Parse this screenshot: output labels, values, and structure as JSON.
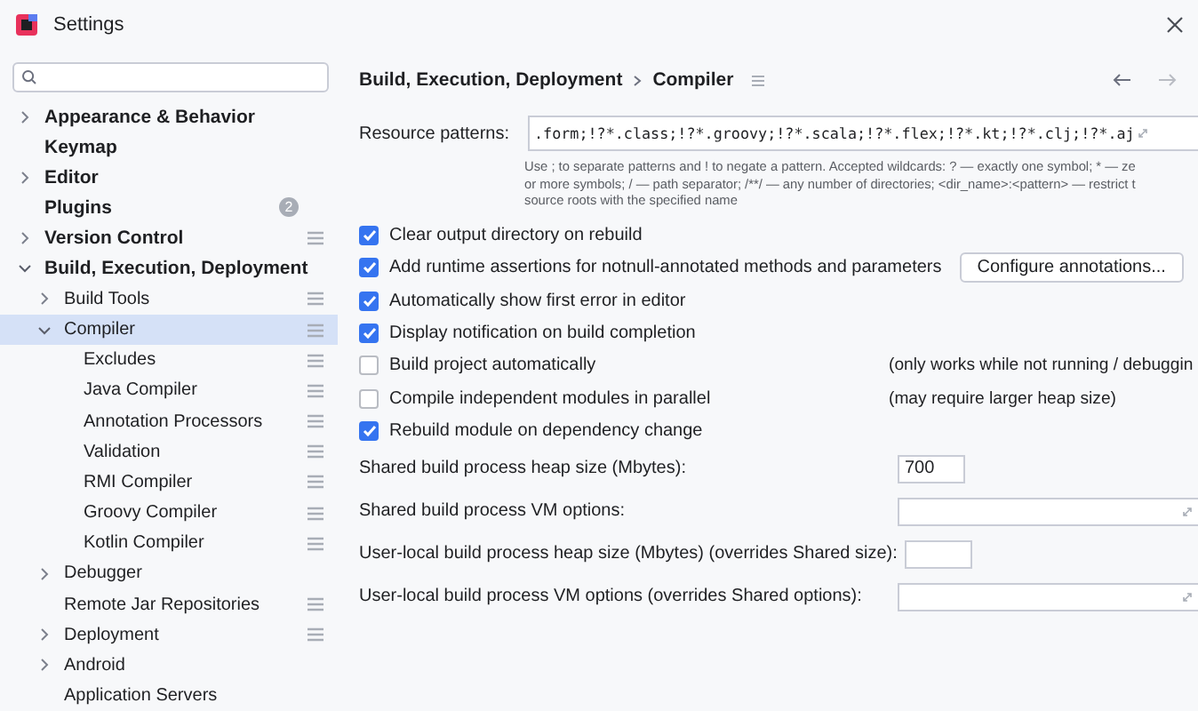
{
  "window": {
    "title": "Settings"
  },
  "sidebar": {
    "items": [
      {
        "label": "Appearance & Behavior",
        "expanded": false,
        "selected": false,
        "settings_icon": false
      },
      {
        "label": "Keymap",
        "selected": false,
        "settings_icon": false
      },
      {
        "label": "Editor",
        "expanded": false,
        "selected": false,
        "settings_icon": false
      },
      {
        "label": "Plugins",
        "selected": false,
        "settings_icon": false,
        "badge": "2"
      },
      {
        "label": "Version Control",
        "expanded": false,
        "selected": false,
        "settings_icon": true
      },
      {
        "label": "Build, Execution, Deployment",
        "expanded": true,
        "selected": false,
        "settings_icon": false,
        "children": [
          {
            "label": "Build Tools",
            "expanded": false,
            "selected": false,
            "settings_icon": true
          },
          {
            "label": "Compiler",
            "expanded": true,
            "selected": true,
            "settings_icon": true,
            "children": [
              {
                "label": "Excludes",
                "selected": false,
                "settings_icon": true
              },
              {
                "label": "Java Compiler",
                "selected": false,
                "settings_icon": true
              },
              {
                "label": "Annotation Processors",
                "selected": false,
                "settings_icon": true
              },
              {
                "label": "Validation",
                "selected": false,
                "settings_icon": true
              },
              {
                "label": "RMI Compiler",
                "selected": false,
                "settings_icon": true
              },
              {
                "label": "Groovy Compiler",
                "selected": false,
                "settings_icon": true
              },
              {
                "label": "Kotlin Compiler",
                "selected": false,
                "settings_icon": true
              }
            ]
          },
          {
            "label": "Debugger",
            "expanded": false,
            "selected": false,
            "settings_icon": false
          },
          {
            "label": "Remote Jar Repositories",
            "selected": false,
            "settings_icon": true
          },
          {
            "label": "Deployment",
            "expanded": false,
            "selected": false,
            "settings_icon": true
          },
          {
            "label": "Android",
            "expanded": false,
            "selected": false,
            "settings_icon": false
          },
          {
            "label": "Application Servers",
            "selected": false,
            "settings_icon": false
          }
        ]
      }
    ]
  },
  "breadcrumb": [
    "Build, Execution, Deployment",
    "Compiler"
  ],
  "resource_patterns": {
    "label": "Resource patterns:",
    "value": ".form;!?*.class;!?*.groovy;!?*.scala;!?*.flex;!?*.kt;!?*.clj;!?*.aj",
    "help_lines": [
      "Use ; to separate patterns and ! to negate a pattern. Accepted wildcards: ? — exactly one symbol; * — ze",
      "or more symbols; / — path separator; /**/ — any number of directories; <dir_name>:<pattern> — restrict t",
      "source roots with the specified name"
    ]
  },
  "options": [
    {
      "label": "Clear output directory on rebuild",
      "checked": true
    },
    {
      "label": "Add runtime assertions for notnull-annotated methods and parameters",
      "checked": true,
      "button": "Configure annotations..."
    },
    {
      "label": "Automatically show first error in editor",
      "checked": true
    },
    {
      "label": "Display notification on build completion",
      "checked": true
    },
    {
      "label": "Build project automatically",
      "checked": false,
      "note": "(only works while not running / debuggin"
    },
    {
      "label": "Compile independent modules in parallel",
      "checked": false,
      "note": "(may require larger heap size)"
    },
    {
      "label": "Rebuild module on dependency change",
      "checked": true
    }
  ],
  "fields": [
    {
      "label": "Shared build process heap size (Mbytes):",
      "kind": "short",
      "value": "700"
    },
    {
      "label": "Shared build process VM options:",
      "kind": "wide"
    },
    {
      "label": "User-local build process heap size (Mbytes) (overrides Shared size):",
      "kind": "short"
    },
    {
      "label": "User-local build process VM options (overrides Shared options):",
      "kind": "wide"
    }
  ]
}
